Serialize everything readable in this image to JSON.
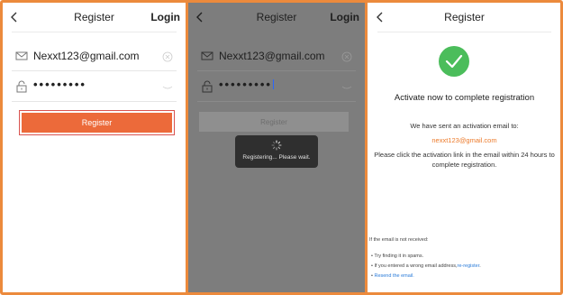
{
  "screen1": {
    "title": "Register",
    "login_label": "Login",
    "email_value": "Nexxt123@gmail.com",
    "password_value": "•••••••••",
    "register_label": "Register"
  },
  "screen2": {
    "title": "Register",
    "login_label": "Login",
    "email_value": "Nexxt123@gmail.com",
    "password_value": "•••••••••",
    "register_label": "Register",
    "toast_message": "Registering... Please wait."
  },
  "screen3": {
    "title": "Register",
    "activate_title": "Activate now to complete registration",
    "sent_text": "We have sent an activation email to:",
    "email": "nexxt123@gmail.com",
    "instruction": "Please click the activation link in the email within 24 hours to complete registration.",
    "not_received": "If the email is not received:",
    "tip_spam": "• Try finding it in spams.",
    "tip_wrong_prefix": "• If you entered a wrong email address,",
    "tip_reregister": "re-register",
    "tip_wrong_suffix": ".",
    "tip_resend_bullet": "• ",
    "tip_resend": "Resend the email."
  },
  "colors": {
    "frame": "#ec8a3c",
    "button": "#ec6a3a",
    "success": "#4bbd5b",
    "link": "#2a7bd9",
    "overlay": "#7d7d7d"
  },
  "icons": [
    "back-icon",
    "mail-icon",
    "lock-icon",
    "clear-icon",
    "eye-closed-icon",
    "spinner-icon",
    "check-icon"
  ]
}
